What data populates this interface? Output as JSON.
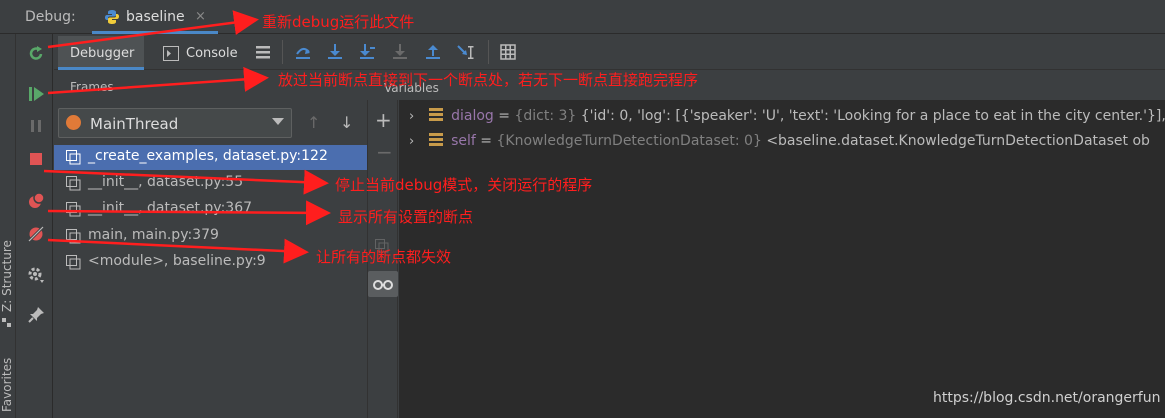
{
  "header": {
    "debug_label": "Debug:",
    "tab_label": "baseline",
    "tab_close": "×"
  },
  "side_strip": {
    "structure_label": "Z: Structure",
    "favorites_label": "Favorites"
  },
  "toolbar": {
    "debugger_tab": "Debugger",
    "console_tab": "Console",
    "icons": [
      "menu-icon",
      "step-over-icon",
      "step-into-icon",
      "step-into-my-code-icon",
      "force-step-into-icon",
      "step-out-icon",
      "run-to-cursor-icon",
      "evaluate-expression-icon"
    ]
  },
  "frames": {
    "header": "Frames",
    "thread": "MainThread",
    "items": [
      {
        "label": "_create_examples, dataset.py:122",
        "selected": true
      },
      {
        "label": "__init__, dataset.py:55",
        "selected": false
      },
      {
        "label": "__init__, dataset.py:367",
        "selected": false
      },
      {
        "label": "main, main.py:379",
        "selected": false
      },
      {
        "label": "<module>, baseline.py:9",
        "selected": false
      }
    ]
  },
  "variables": {
    "header": "Variables",
    "items": [
      {
        "name": "dialog",
        "type": "{dict: 3}",
        "value": "{'id': 0, 'log': [{'speaker': 'U', 'text': 'Looking for a place to eat in the city center.'}],"
      },
      {
        "name": "self",
        "type": "{KnowledgeTurnDetectionDataset: 0}",
        "value": "<baseline.dataset.KnowledgeTurnDetectionDataset ob"
      }
    ]
  },
  "annotations": {
    "rerun": "重新debug运行此文件",
    "resume": "放过当前断点直接到下一个断点处，若无下一断点直接跑完程序",
    "stop": "停止当前debug模式，关闭运行的程序",
    "view_breakpoints": "显示所有设置的断点",
    "mute_breakpoints": "让所有的断点都失效"
  },
  "watermark": "https://blog.csdn.net/orangerfun",
  "colors": {
    "annotation": "#ff1e1e",
    "selection": "#4b6eaf",
    "accent": "#4a88c7",
    "variable_name": "#9876aa"
  }
}
